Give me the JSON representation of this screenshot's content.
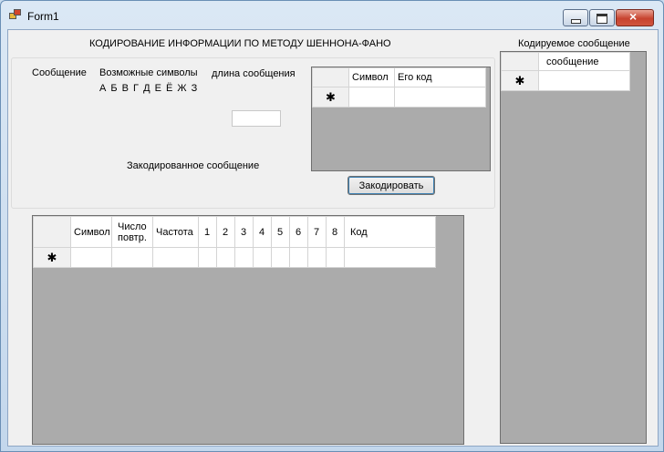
{
  "window": {
    "title": "Form1"
  },
  "header": {
    "title": "КОДИРОВАНИЕ ИНФОРМАЦИИ ПО МЕТОДУ ШЕННОНА-ФАНО"
  },
  "form": {
    "message_label": "Сообщение",
    "symbols_label": "Возможные символы",
    "symbols_value": "А Б В Г Д Е Ё Ж З",
    "length_label": "длина сообщения",
    "length_value": "",
    "encoded_label": "Закодированное сообщение",
    "encode_button": "Закодировать"
  },
  "code_grid": {
    "columns": [
      "Символ",
      "Его код"
    ],
    "new_row_marker": "✱"
  },
  "freq_grid": {
    "columns": [
      "Символ",
      "Число повтр.",
      "Частота",
      "1",
      "2",
      "3",
      "4",
      "5",
      "6",
      "7",
      "8",
      "Код"
    ],
    "new_row_marker": "✱"
  },
  "message_panel": {
    "title": "Кодируемое сообщение",
    "columns": [
      "сообщение"
    ],
    "new_row_marker": "✱"
  }
}
